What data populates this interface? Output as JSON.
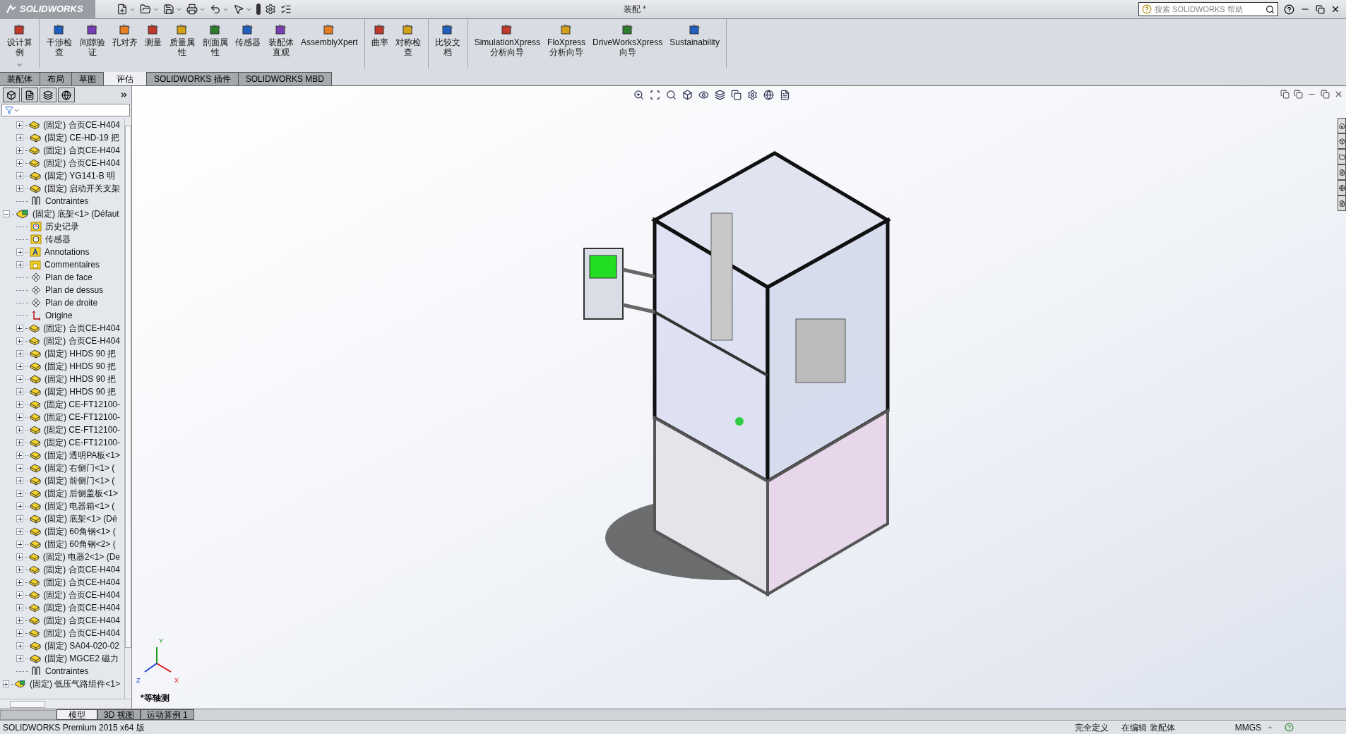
{
  "app": {
    "logo": "SOLIDWORKS",
    "title": "装配 *",
    "search": {
      "placeholder": "搜索 SOLIDWORKS 帮助"
    }
  },
  "ribbon": {
    "groups": [
      [
        {
          "label": "设计算例",
          "kind": "narrow",
          "dropdown": true
        }
      ],
      [
        {
          "label": "干涉检查",
          "kind": "narrow",
          "dropdown": false
        },
        {
          "label": "间隙验证",
          "kind": "narrow",
          "dropdown": false
        },
        {
          "label": "孔对齐",
          "kind": "narrow",
          "dropdown": false
        },
        {
          "label": "测量",
          "kind": "narrow",
          "dropdown": false
        },
        {
          "label": "质量属性",
          "kind": "narrow",
          "dropdown": false
        },
        {
          "label": "剖面属性",
          "kind": "narrow",
          "dropdown": false
        },
        {
          "label": "传感器",
          "kind": "narrow",
          "dropdown": false
        },
        {
          "label": "装配体直观",
          "kind": "narrow",
          "dropdown": false
        },
        {
          "label": "AssemblyXpert",
          "kind": "wide",
          "dropdown": false
        }
      ],
      [
        {
          "label": "曲率",
          "kind": "narrow",
          "dropdown": false
        },
        {
          "label": "对称检查",
          "kind": "narrow",
          "dropdown": false
        }
      ],
      [
        {
          "label": "比较文档",
          "kind": "narrow",
          "dropdown": false
        }
      ],
      [
        {
          "label": "SimulationXpress\n分析向导",
          "dropdown": false
        },
        {
          "label": "FloXpress\n分析向导",
          "dropdown": false
        },
        {
          "label": "DriveWorksXpress\n向导",
          "dropdown": false
        },
        {
          "label": "Sustainability",
          "dropdown": false
        }
      ]
    ]
  },
  "tabs": [
    {
      "label": "装配体",
      "selected": false
    },
    {
      "label": "布局",
      "selected": false
    },
    {
      "label": "草图",
      "selected": false
    },
    {
      "label": "评估",
      "selected": true
    },
    {
      "label": "SOLIDWORKS 插件",
      "selected": false
    },
    {
      "label": "SOLIDWORKS MBD",
      "selected": false
    }
  ],
  "tree": {
    "continued_items": [
      {
        "label": "(固定) 合页CE-H404",
        "kind": "part",
        "expanded": false
      },
      {
        "label": "(固定) CE-HD-19 把",
        "kind": "part",
        "expanded": false
      },
      {
        "label": "(固定) 合页CE-H404",
        "kind": "part",
        "expanded": false
      },
      {
        "label": "(固定) 合页CE-H404",
        "kind": "part",
        "expanded": false
      },
      {
        "label": "(固定) YG141-B 明",
        "kind": "part",
        "expanded": false
      },
      {
        "label": "(固定) 启动开关支架",
        "kind": "part",
        "expanded": false
      },
      {
        "label": "Contraintes",
        "kind": "mates"
      }
    ],
    "items": [
      {
        "label": "(固定) 底架<1> (Défaut",
        "kind": "assembly",
        "expanded": true,
        "children": [
          {
            "label": "历史记录",
            "kind": "history"
          },
          {
            "label": "传感器",
            "kind": "sensor"
          },
          {
            "label": "Annotations",
            "kind": "annotations",
            "expanded": false
          },
          {
            "label": "Commentaires",
            "kind": "folder",
            "expanded": false
          },
          {
            "label": "Plan de face",
            "kind": "plane"
          },
          {
            "label": "Plan de dessus",
            "kind": "plane"
          },
          {
            "label": "Plan de droite",
            "kind": "plane"
          },
          {
            "label": "Origine",
            "kind": "origin"
          },
          {
            "label": "(固定) 合页CE-H404",
            "kind": "part",
            "expanded": false
          },
          {
            "label": "(固定) 合页CE-H404",
            "kind": "part",
            "expanded": false
          },
          {
            "label": "(固定) HHDS 90 把",
            "kind": "part",
            "expanded": false
          },
          {
            "label": "(固定) HHDS 90 把",
            "kind": "part",
            "expanded": false
          },
          {
            "label": "(固定) HHDS 90 把",
            "kind": "part",
            "expanded": false
          },
          {
            "label": "(固定) HHDS 90 把",
            "kind": "part",
            "expanded": false
          },
          {
            "label": "(固定) CE-FT12100-",
            "kind": "part",
            "expanded": false
          },
          {
            "label": "(固定) CE-FT12100-",
            "kind": "part",
            "expanded": false
          },
          {
            "label": "(固定) CE-FT12100-",
            "kind": "part",
            "expanded": false
          },
          {
            "label": "(固定) CE-FT12100-",
            "kind": "part",
            "expanded": false
          },
          {
            "label": "(固定) 透明PA板<1>",
            "kind": "part",
            "expanded": false
          },
          {
            "label": "(固定) 右侧门<1> (",
            "kind": "part",
            "expanded": false
          },
          {
            "label": "(固定) 前侧门<1> (",
            "kind": "part",
            "expanded": false
          },
          {
            "label": "(固定) 后侧盖板<1>",
            "kind": "part",
            "expanded": false
          },
          {
            "label": "(固定) 电器箱<1> (",
            "kind": "part",
            "expanded": false
          },
          {
            "label": "(固定) 底架<1> (Dé",
            "kind": "part",
            "expanded": false
          },
          {
            "label": "(固定) 60角钢<1> (",
            "kind": "part",
            "expanded": false
          },
          {
            "label": "(固定) 60角钢<2> (",
            "kind": "part",
            "expanded": false
          },
          {
            "label": "(固定) 电器2<1> (De",
            "kind": "part",
            "expanded": false
          },
          {
            "label": "(固定) 合页CE-H404",
            "kind": "part",
            "expanded": false
          },
          {
            "label": "(固定) 合页CE-H404",
            "kind": "part",
            "expanded": false
          },
          {
            "label": "(固定) 合页CE-H404",
            "kind": "part",
            "expanded": false
          },
          {
            "label": "(固定) 合页CE-H404",
            "kind": "part",
            "expanded": false
          },
          {
            "label": "(固定) 合页CE-H404",
            "kind": "part",
            "expanded": false
          },
          {
            "label": "(固定) 合页CE-H404",
            "kind": "part",
            "expanded": false
          },
          {
            "label": "(固定) SA04-020-02",
            "kind": "part",
            "expanded": false
          },
          {
            "label": "(固定) MGCE2 磁力",
            "kind": "part",
            "expanded": false
          },
          {
            "label": "Contraintes",
            "kind": "mates"
          }
        ]
      },
      {
        "label": "(固定) 低压气路组件<1>",
        "kind": "assembly",
        "expanded": false
      }
    ]
  },
  "bottom_tabs": [
    {
      "label": "模型",
      "selected": true
    },
    {
      "label": "3D 视图",
      "selected": false
    },
    {
      "label": "运动算例 1",
      "selected": false
    }
  ],
  "viewport": {
    "view_label": "*等轴测",
    "triad": {
      "x": "X",
      "y": "Y",
      "z": "Z"
    }
  },
  "status_bar": {
    "product": "SOLIDWORKS Premium 2015 x64 版",
    "state": "完全定义",
    "editing": "在编辑 装配体",
    "units": "MMGS"
  }
}
